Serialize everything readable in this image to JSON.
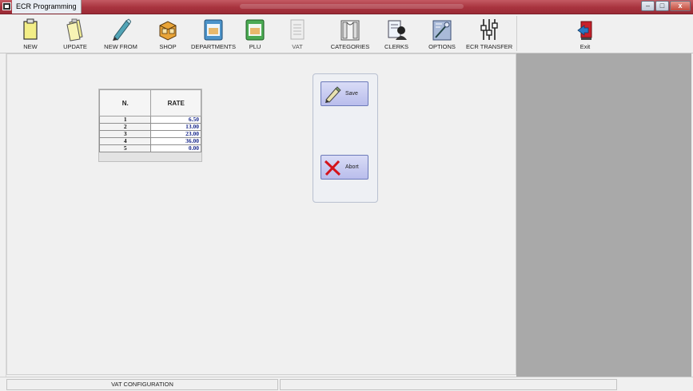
{
  "window": {
    "title": "ECR Programming"
  },
  "toolbar": {
    "new": "NEW",
    "update": "UPDATE",
    "new_from": "NEW FROM",
    "shop": "SHOP",
    "departments": "DEPARTMENTS",
    "plu": "PLU",
    "vat": "VAT",
    "categories": "CATEGORIES",
    "clerks": "CLERKS",
    "options": "OPTIONS",
    "ecr_transfer": "ECR TRANSFER",
    "exit": "Exit"
  },
  "vat_table": {
    "headers": {
      "n": "N.",
      "rate": "RATE"
    },
    "rows": [
      {
        "n": "1",
        "rate": "6.50"
      },
      {
        "n": "2",
        "rate": "13.00"
      },
      {
        "n": "3",
        "rate": "23.00"
      },
      {
        "n": "4",
        "rate": "36.00"
      },
      {
        "n": "5",
        "rate": "0.00"
      }
    ]
  },
  "actions": {
    "save": "Save",
    "abort": "Abort"
  },
  "status": {
    "left": "VAT CONFIGURATION",
    "right": ""
  },
  "colors": {
    "titlebar": "#a8333e",
    "rate_text": "#1a2a8c",
    "right_panel": "#a9a9a9",
    "button_fill": "#c9ccf1"
  },
  "icons": [
    "new-icon",
    "update-icon",
    "new-from-icon",
    "shop-icon",
    "departments-icon",
    "plu-icon",
    "vat-icon",
    "categories-icon",
    "clerks-icon",
    "options-icon",
    "ecr-transfer-icon",
    "exit-icon",
    "save-pencil-icon",
    "abort-x-icon"
  ]
}
